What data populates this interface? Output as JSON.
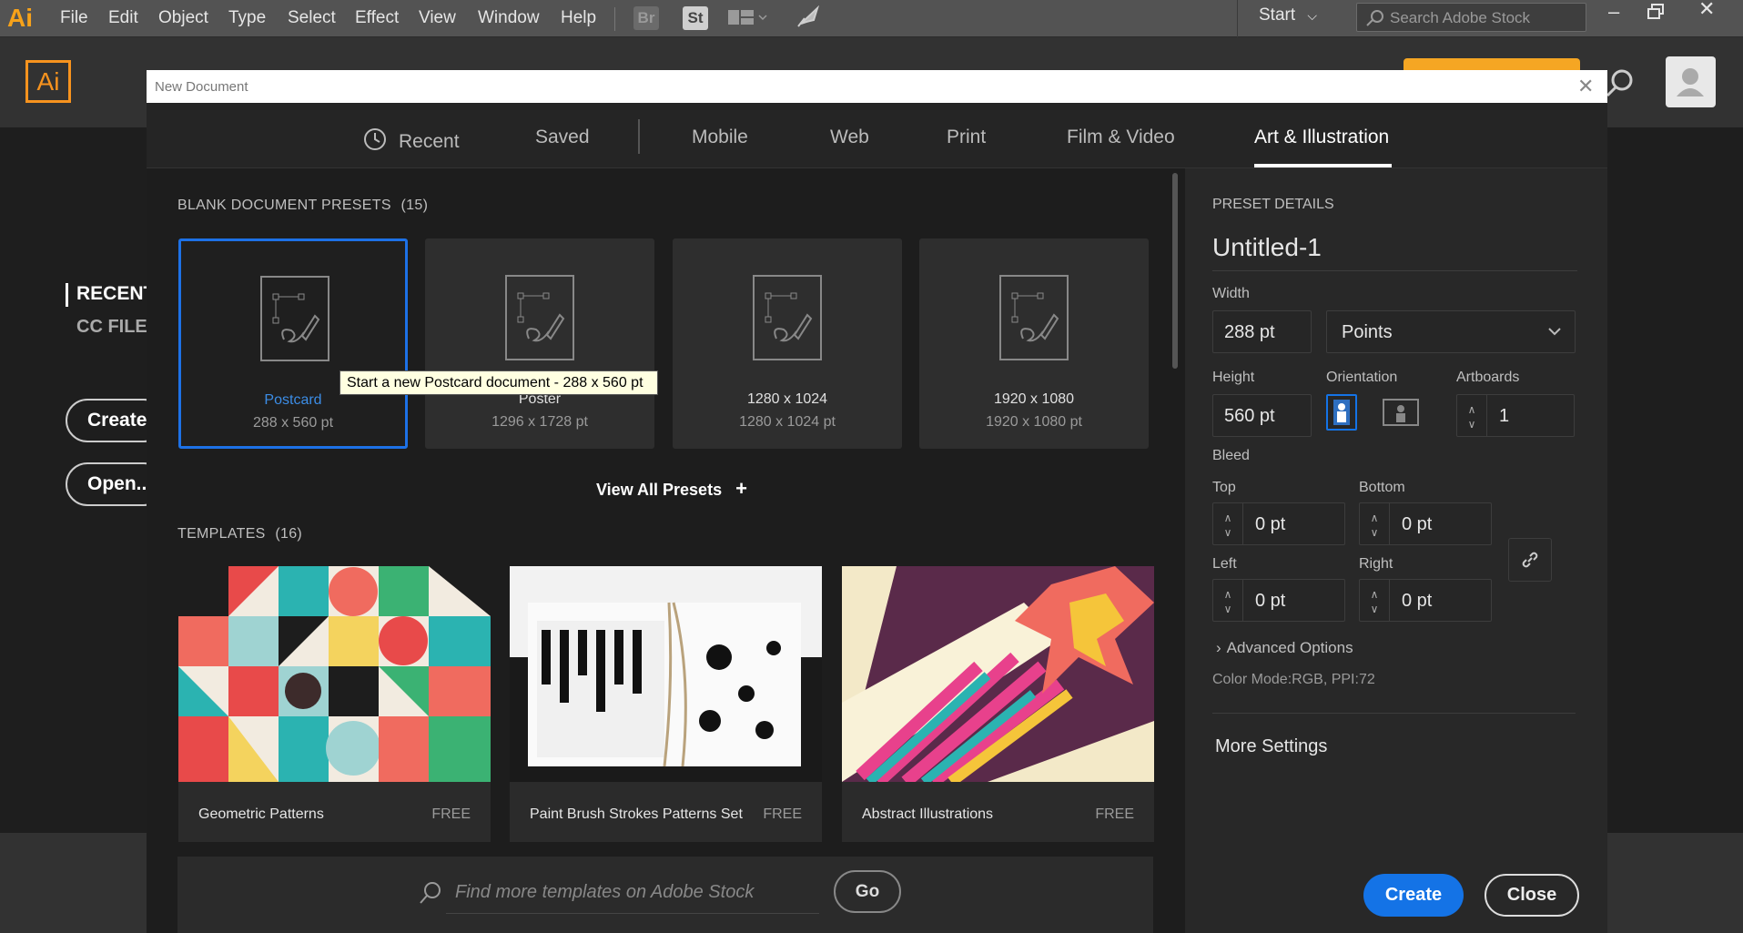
{
  "menubar": {
    "logo": "Ai",
    "items": [
      "File",
      "Edit",
      "Object",
      "Type",
      "Select",
      "Effect",
      "View",
      "Window",
      "Help"
    ],
    "bridge": "Br",
    "stock": "St",
    "workspace": "Start",
    "search_placeholder": "Search Adobe Stock"
  },
  "home": {
    "logo": "Ai",
    "recent": "RECENT",
    "cc_files": "CC FILES",
    "create": "Create",
    "open": "Open..."
  },
  "dialog": {
    "title": "New Document",
    "tabs": [
      {
        "label": "Recent",
        "icon": "clock-icon"
      },
      {
        "label": "Saved"
      },
      {
        "label": "Mobile"
      },
      {
        "label": "Web"
      },
      {
        "label": "Print"
      },
      {
        "label": "Film & Video"
      },
      {
        "label": "Art & Illustration",
        "active": true
      }
    ],
    "presets_heading": "BLANK DOCUMENT PRESETS",
    "presets_count": "(15)",
    "presets": [
      {
        "name": "Postcard",
        "size": "288 x 560 pt",
        "selected": true
      },
      {
        "name": "Poster",
        "size": "1296 x 1728 pt"
      },
      {
        "name": "1280 x 1024",
        "size": "1280 x 1024 pt"
      },
      {
        "name": "1920 x 1080",
        "size": "1920 x 1080 pt"
      }
    ],
    "tooltip": "Start a new Postcard document - 288 x 560 pt",
    "view_all": "View All Presets",
    "templates_heading": "TEMPLATES",
    "templates_count": "(16)",
    "templates": [
      {
        "name": "Geometric Patterns",
        "price": "FREE"
      },
      {
        "name": "Paint Brush Strokes Patterns Set",
        "price": "FREE"
      },
      {
        "name": "Abstract Illustrations",
        "price": "FREE"
      }
    ],
    "stock_placeholder": "Find more templates on Adobe Stock",
    "go": "Go"
  },
  "details": {
    "heading": "PRESET DETAILS",
    "doc_name": "Untitled-1",
    "width_label": "Width",
    "width": "288 pt",
    "units": "Points",
    "height_label": "Height",
    "height": "560 pt",
    "orientation_label": "Orientation",
    "artboards_label": "Artboards",
    "artboards": "1",
    "bleed_label": "Bleed",
    "top_label": "Top",
    "top": "0 pt",
    "bottom_label": "Bottom",
    "bottom": "0 pt",
    "left_label": "Left",
    "left": "0 pt",
    "right_label": "Right",
    "right": "0 pt",
    "advanced": "Advanced Options",
    "color_mode": "Color Mode:RGB, PPI:72",
    "more_settings": "More Settings",
    "create": "Create",
    "close": "Close"
  },
  "colors": {
    "accent": "#1473e6",
    "ai_orange": "#f7931e"
  }
}
